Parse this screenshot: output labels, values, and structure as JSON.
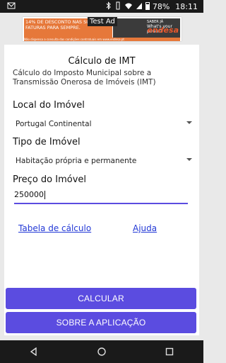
{
  "status_bar": {
    "battery": "78%",
    "time": "18:11"
  },
  "ad": {
    "label": "Test Ad",
    "text": "14% DE DESCONTO NAS SUAS FATURAS PARA SEMPRE.",
    "small_text": "SABER JÁ",
    "sub_text": "What's your power?",
    "brand": "endesa",
    "disclaimer": "Não dispensa a consulta das condições contratuais em www.endesa.pt"
  },
  "header": {
    "title": "Cálculo de IMT",
    "subtitle": "Cálculo do Imposto Municipal sobre a Transmissão Onerosa de Imóveis (IMT)"
  },
  "form": {
    "local_label": "Local do Imóvel",
    "local_value": "Portugal Continental",
    "tipo_label": "Tipo de Imóvel",
    "tipo_value": "Habitação própria e permanente",
    "preco_label": "Preço do Imóvel",
    "preco_value": "250000"
  },
  "links": {
    "tabela": "Tabela de cálculo",
    "ajuda": "Ajuda"
  },
  "buttons": {
    "calcular": "CALCULAR",
    "sobre": "SOBRE A APLICAÇÃO"
  },
  "colors": {
    "accent": "#5b4ce0",
    "link": "#2238d6"
  }
}
